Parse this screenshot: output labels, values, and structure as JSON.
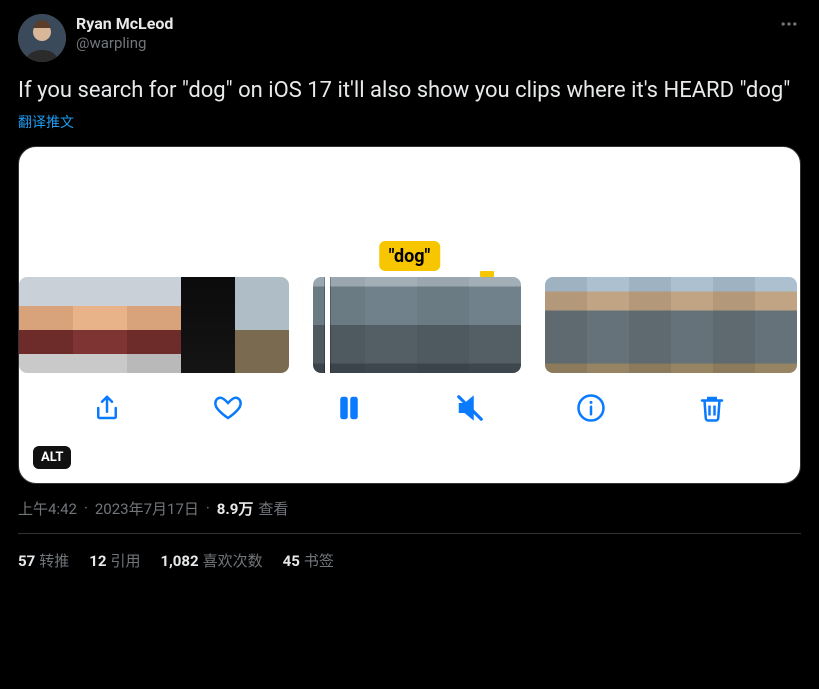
{
  "author": {
    "displayName": "Ryan McLeod",
    "handle": "@warpling"
  },
  "tweet": {
    "text": "If you search for \"dog\" on iOS 17 it'll also show you clips where it's HEARD \"dog\"",
    "translateLabel": "翻译推文",
    "altBadge": "ALT",
    "searchTag": "\"dog\""
  },
  "meta": {
    "time": "上午4:42",
    "date": "2023年7月17日",
    "viewsCount": "8.9万",
    "viewsLabel": "查看"
  },
  "stats": {
    "retweets": {
      "count": "57",
      "label": "转推"
    },
    "quotes": {
      "count": "12",
      "label": "引用"
    },
    "likes": {
      "count": "1,082",
      "label": "喜欢次数"
    },
    "bookmarks": {
      "count": "45",
      "label": "书签"
    }
  },
  "toolbarIcons": {
    "share": "share-icon",
    "like": "heart-icon",
    "pause": "pause-icon",
    "mute": "mute-icon",
    "info": "info-icon",
    "trash": "trash-icon"
  }
}
